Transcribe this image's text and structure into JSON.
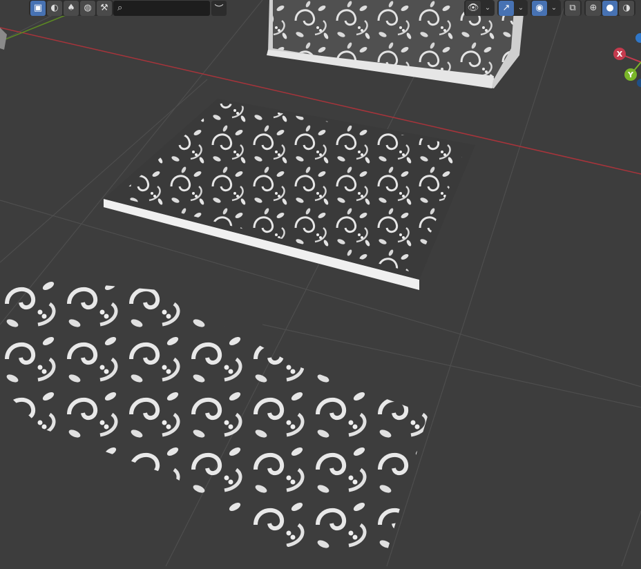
{
  "toolbar": {
    "select_modes": [
      "select-box",
      "shading-solid",
      "paint",
      "world",
      "brush"
    ],
    "search": {
      "placeholder": "",
      "value": ""
    },
    "visibility": {
      "icon": "eye-icon"
    },
    "gizmo_toggle": {
      "icon": "gizmo-icon"
    },
    "overlay_toggle": {
      "icon": "overlay-icon"
    },
    "xray_toggle": {
      "icon": "xray-icon"
    },
    "shading_modes": [
      "wireframe",
      "solid",
      "material"
    ]
  },
  "nav_gizmo": {
    "x_label": "X",
    "y_label": "Y",
    "colors": {
      "x": "#c43a4d",
      "y": "#7ab629",
      "z": "#2f77c9"
    }
  },
  "viewport": {
    "background": "#3d3d3d",
    "grid_color": "#4e4e4e",
    "x_axis_color": "#a8343b",
    "y_axis_color": "#5c8a22"
  }
}
